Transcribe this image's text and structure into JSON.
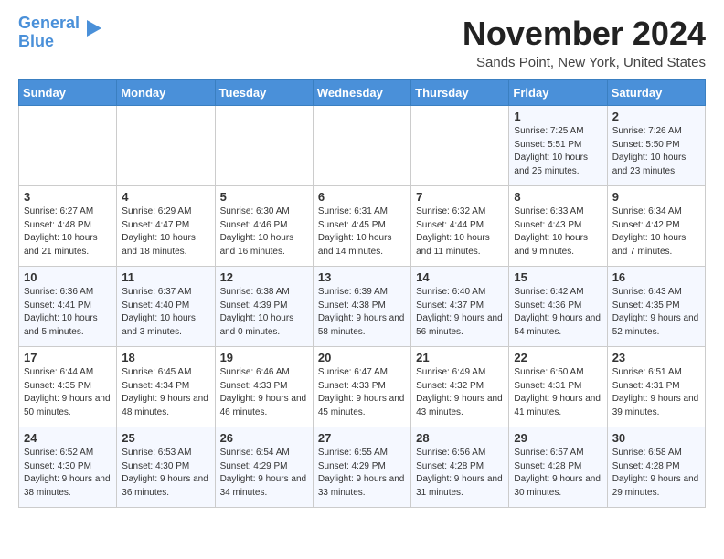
{
  "logo": {
    "line1": "General",
    "line2": "Blue"
  },
  "title": "November 2024",
  "location": "Sands Point, New York, United States",
  "days_of_week": [
    "Sunday",
    "Monday",
    "Tuesday",
    "Wednesday",
    "Thursday",
    "Friday",
    "Saturday"
  ],
  "weeks": [
    [
      {
        "day": "",
        "detail": ""
      },
      {
        "day": "",
        "detail": ""
      },
      {
        "day": "",
        "detail": ""
      },
      {
        "day": "",
        "detail": ""
      },
      {
        "day": "",
        "detail": ""
      },
      {
        "day": "1",
        "detail": "Sunrise: 7:25 AM\nSunset: 5:51 PM\nDaylight: 10 hours and 25 minutes."
      },
      {
        "day": "2",
        "detail": "Sunrise: 7:26 AM\nSunset: 5:50 PM\nDaylight: 10 hours and 23 minutes."
      }
    ],
    [
      {
        "day": "3",
        "detail": "Sunrise: 6:27 AM\nSunset: 4:48 PM\nDaylight: 10 hours and 21 minutes."
      },
      {
        "day": "4",
        "detail": "Sunrise: 6:29 AM\nSunset: 4:47 PM\nDaylight: 10 hours and 18 minutes."
      },
      {
        "day": "5",
        "detail": "Sunrise: 6:30 AM\nSunset: 4:46 PM\nDaylight: 10 hours and 16 minutes."
      },
      {
        "day": "6",
        "detail": "Sunrise: 6:31 AM\nSunset: 4:45 PM\nDaylight: 10 hours and 14 minutes."
      },
      {
        "day": "7",
        "detail": "Sunrise: 6:32 AM\nSunset: 4:44 PM\nDaylight: 10 hours and 11 minutes."
      },
      {
        "day": "8",
        "detail": "Sunrise: 6:33 AM\nSunset: 4:43 PM\nDaylight: 10 hours and 9 minutes."
      },
      {
        "day": "9",
        "detail": "Sunrise: 6:34 AM\nSunset: 4:42 PM\nDaylight: 10 hours and 7 minutes."
      }
    ],
    [
      {
        "day": "10",
        "detail": "Sunrise: 6:36 AM\nSunset: 4:41 PM\nDaylight: 10 hours and 5 minutes."
      },
      {
        "day": "11",
        "detail": "Sunrise: 6:37 AM\nSunset: 4:40 PM\nDaylight: 10 hours and 3 minutes."
      },
      {
        "day": "12",
        "detail": "Sunrise: 6:38 AM\nSunset: 4:39 PM\nDaylight: 10 hours and 0 minutes."
      },
      {
        "day": "13",
        "detail": "Sunrise: 6:39 AM\nSunset: 4:38 PM\nDaylight: 9 hours and 58 minutes."
      },
      {
        "day": "14",
        "detail": "Sunrise: 6:40 AM\nSunset: 4:37 PM\nDaylight: 9 hours and 56 minutes."
      },
      {
        "day": "15",
        "detail": "Sunrise: 6:42 AM\nSunset: 4:36 PM\nDaylight: 9 hours and 54 minutes."
      },
      {
        "day": "16",
        "detail": "Sunrise: 6:43 AM\nSunset: 4:35 PM\nDaylight: 9 hours and 52 minutes."
      }
    ],
    [
      {
        "day": "17",
        "detail": "Sunrise: 6:44 AM\nSunset: 4:35 PM\nDaylight: 9 hours and 50 minutes."
      },
      {
        "day": "18",
        "detail": "Sunrise: 6:45 AM\nSunset: 4:34 PM\nDaylight: 9 hours and 48 minutes."
      },
      {
        "day": "19",
        "detail": "Sunrise: 6:46 AM\nSunset: 4:33 PM\nDaylight: 9 hours and 46 minutes."
      },
      {
        "day": "20",
        "detail": "Sunrise: 6:47 AM\nSunset: 4:33 PM\nDaylight: 9 hours and 45 minutes."
      },
      {
        "day": "21",
        "detail": "Sunrise: 6:49 AM\nSunset: 4:32 PM\nDaylight: 9 hours and 43 minutes."
      },
      {
        "day": "22",
        "detail": "Sunrise: 6:50 AM\nSunset: 4:31 PM\nDaylight: 9 hours and 41 minutes."
      },
      {
        "day": "23",
        "detail": "Sunrise: 6:51 AM\nSunset: 4:31 PM\nDaylight: 9 hours and 39 minutes."
      }
    ],
    [
      {
        "day": "24",
        "detail": "Sunrise: 6:52 AM\nSunset: 4:30 PM\nDaylight: 9 hours and 38 minutes."
      },
      {
        "day": "25",
        "detail": "Sunrise: 6:53 AM\nSunset: 4:30 PM\nDaylight: 9 hours and 36 minutes."
      },
      {
        "day": "26",
        "detail": "Sunrise: 6:54 AM\nSunset: 4:29 PM\nDaylight: 9 hours and 34 minutes."
      },
      {
        "day": "27",
        "detail": "Sunrise: 6:55 AM\nSunset: 4:29 PM\nDaylight: 9 hours and 33 minutes."
      },
      {
        "day": "28",
        "detail": "Sunrise: 6:56 AM\nSunset: 4:28 PM\nDaylight: 9 hours and 31 minutes."
      },
      {
        "day": "29",
        "detail": "Sunrise: 6:57 AM\nSunset: 4:28 PM\nDaylight: 9 hours and 30 minutes."
      },
      {
        "day": "30",
        "detail": "Sunrise: 6:58 AM\nSunset: 4:28 PM\nDaylight: 9 hours and 29 minutes."
      }
    ]
  ]
}
